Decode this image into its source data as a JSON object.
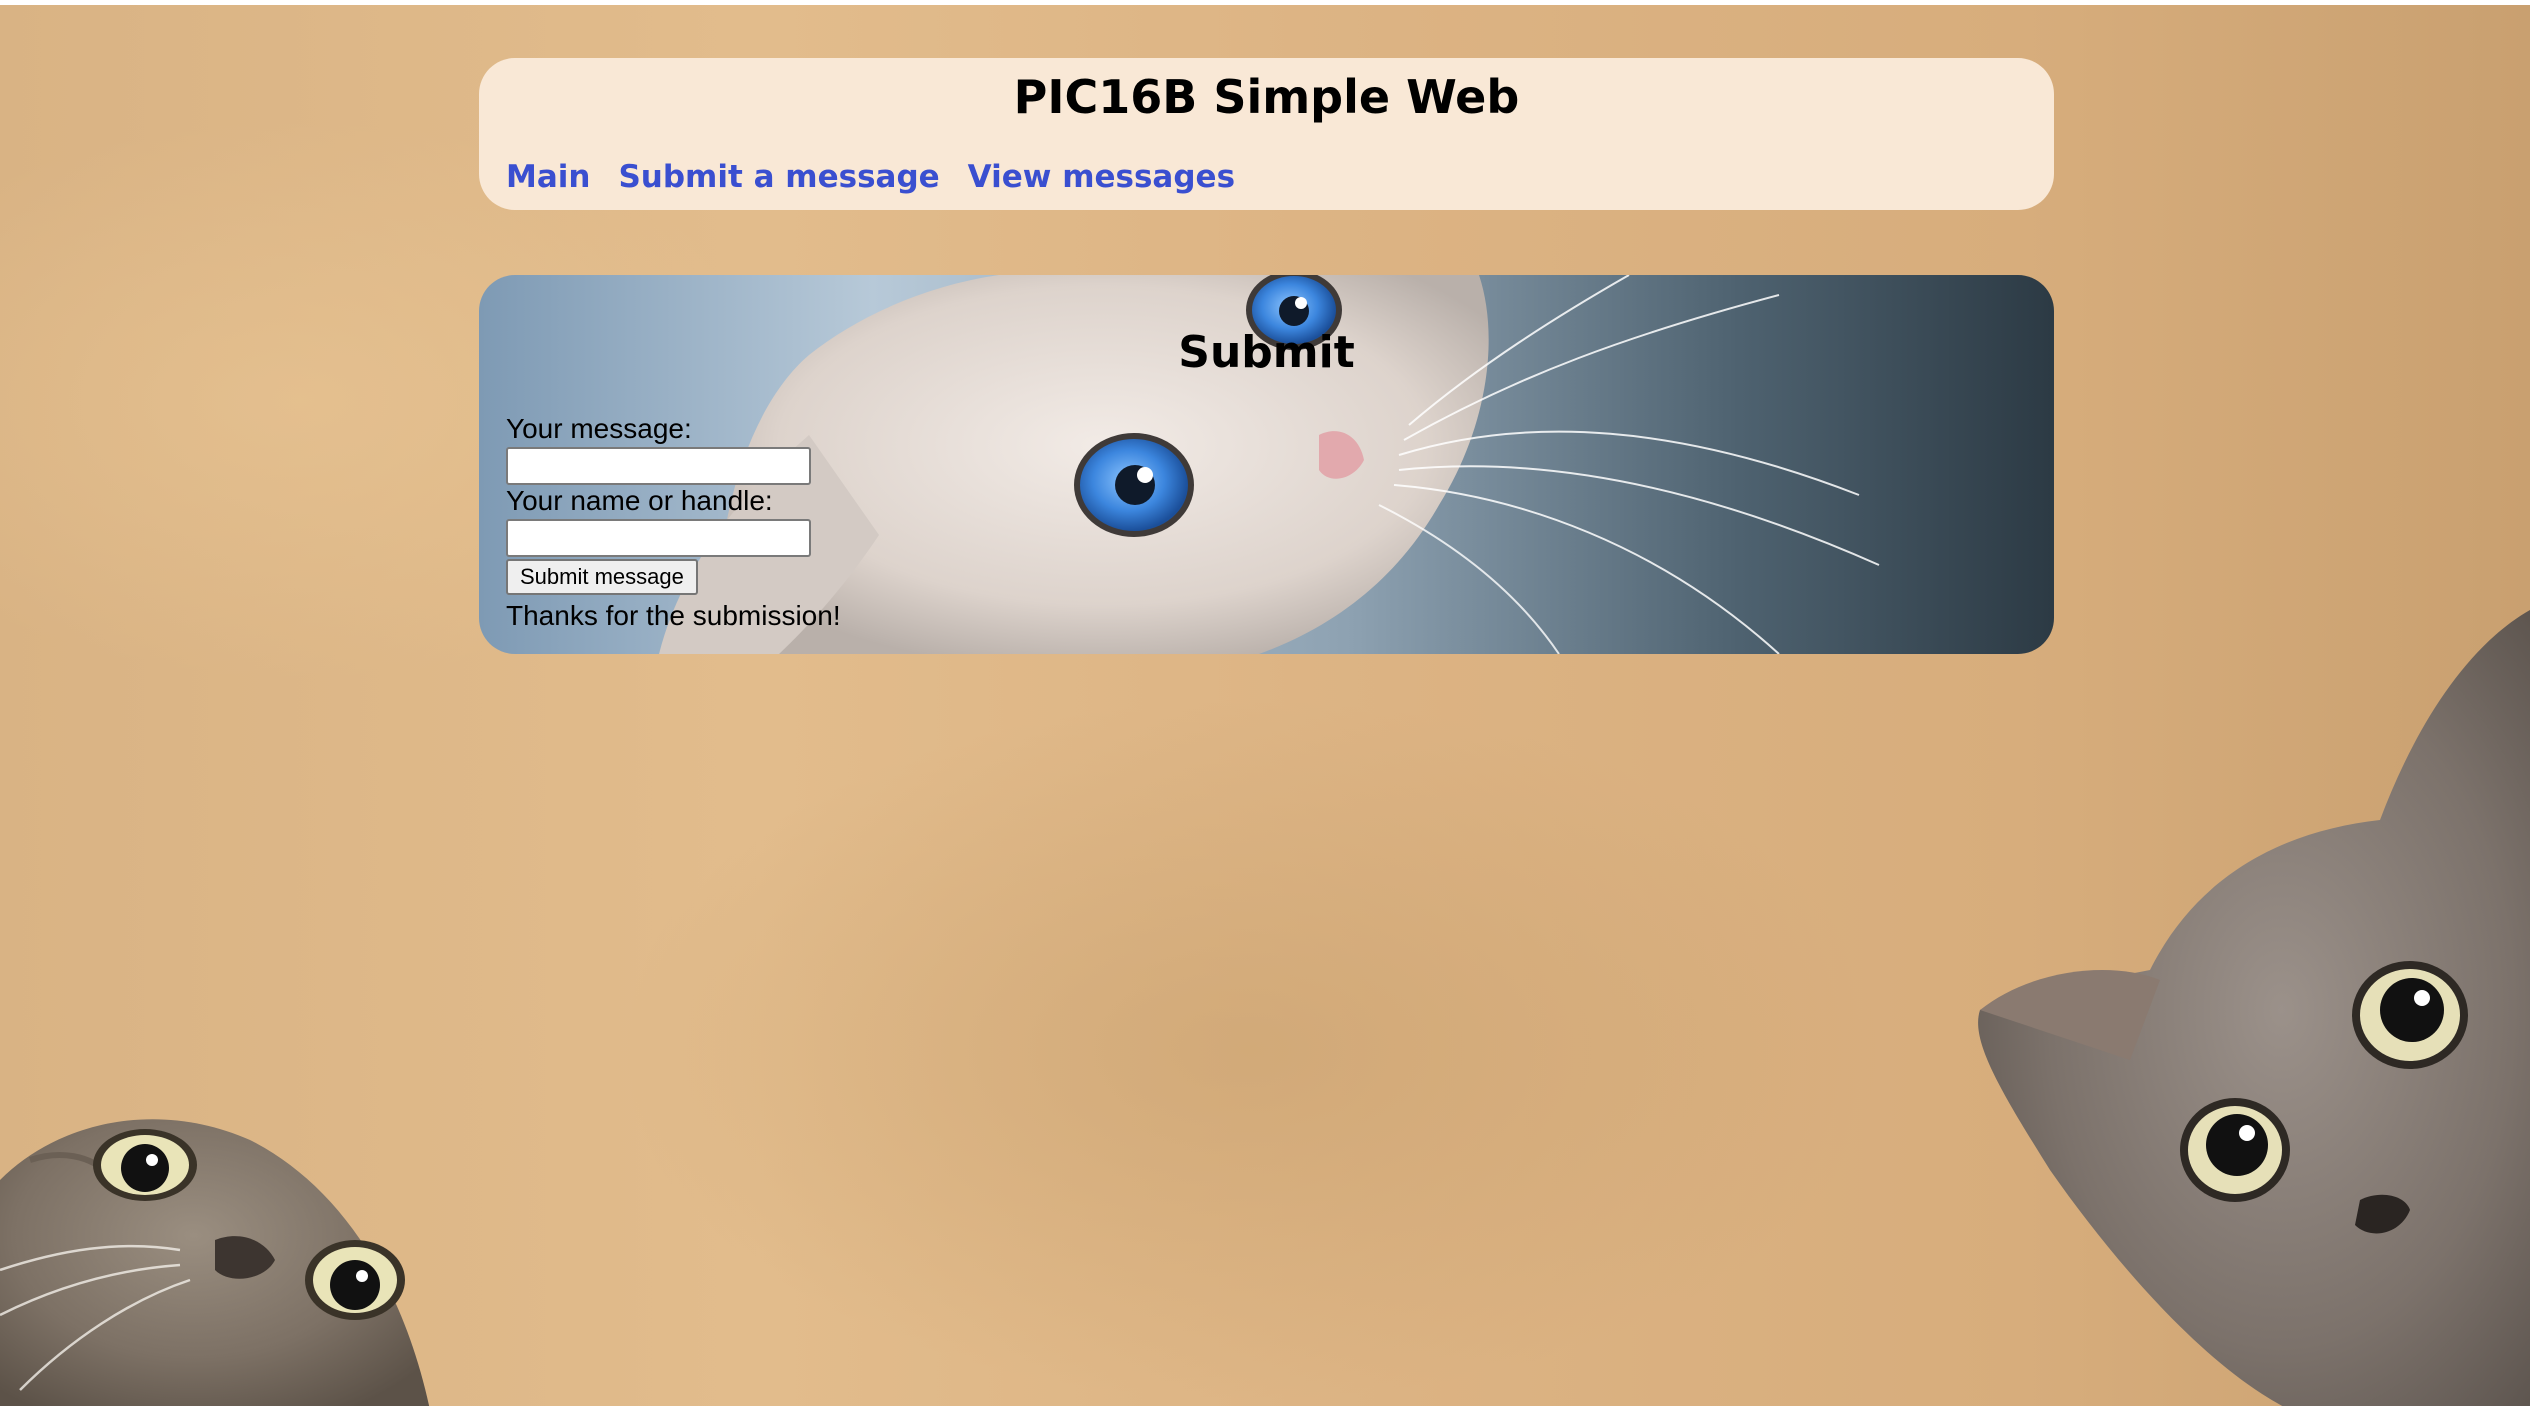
{
  "header": {
    "title": "PIC16B Simple Web",
    "nav": [
      {
        "label": "Main"
      },
      {
        "label": "Submit a message"
      },
      {
        "label": "View messages"
      }
    ]
  },
  "submit_section": {
    "title": "Submit",
    "message_label": "Your message:",
    "message_value": "",
    "handle_label": "Your name or handle:",
    "handle_value": "",
    "submit_button": "Submit message",
    "thanks_text": "Thanks for the submission!"
  },
  "colors": {
    "header_bg": "#f9e8d6",
    "link": "#3a4fd0",
    "page_bg": "#e0b98a"
  },
  "images": {
    "background": "two-gray-cats-peeking-photo",
    "banner": "white-kitten-blue-eyes-photo"
  }
}
